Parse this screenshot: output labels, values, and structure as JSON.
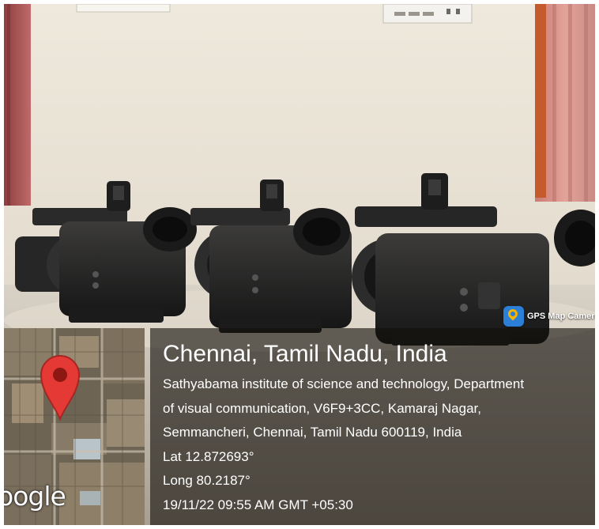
{
  "watermark": {
    "app_label": "GPS Map Camera",
    "app_icon": "gps-map-camera-icon",
    "map_provider_label": "Google",
    "map_pin_icon": "map-pin-icon"
  },
  "location": {
    "title": "Chennai, Tamil Nadu, India",
    "address_lines": [
      "Sathyabama institute of science and technology, Department",
      "of visual communication, V6F9+3CC, Kamaraj Nagar,",
      "Semmancheri, Chennai, Tamil Nadu 600119, India"
    ],
    "latitude": "Lat 12.872693°",
    "longitude": "Long 80.2187°",
    "timestamp": "19/11/22 09:55 AM GMT +05:30"
  },
  "colors": {
    "overlay": "#14100c",
    "pin": "#e53935",
    "wall": "#e6ded0",
    "curtain": "#b0575a"
  }
}
